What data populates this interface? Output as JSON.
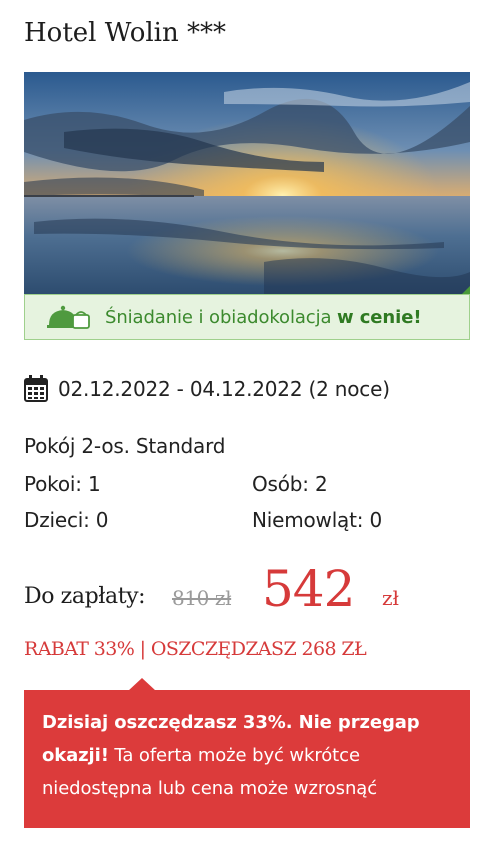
{
  "hotel": {
    "title": "Hotel Wolin ***"
  },
  "meal_banner": {
    "text": "Śniadanie i obiadokolacja ",
    "highlight": "w cenie!",
    "icon": "meal-cloche-icon"
  },
  "stay": {
    "dates": "02.12.2022 - 04.12.2022 (2 noce)",
    "icon": "calendar-icon"
  },
  "room": {
    "name": "Pokój 2-os. Standard",
    "rooms": "Pokoi: 1",
    "persons": "Osób: 2",
    "children": "Dzieci: 0",
    "infants": "Niemowląt: 0"
  },
  "price": {
    "label": "Do zapłaty:",
    "old": "810 zł",
    "new": "542",
    "currency": "zł"
  },
  "discount": {
    "text": "RABAT 33% | OSZCZĘDZASZ 268 ZŁ"
  },
  "alert": {
    "bold": "Dzisiaj oszczędzasz 33%. Nie przegap okazji!",
    "text": " Ta oferta może być wkrótce niedostępna lub cena może wzrosnąć"
  },
  "colors": {
    "accent_red": "#dc3b3b",
    "banner_green": "#3c8a2e",
    "banner_bg": "#e6f3df"
  }
}
